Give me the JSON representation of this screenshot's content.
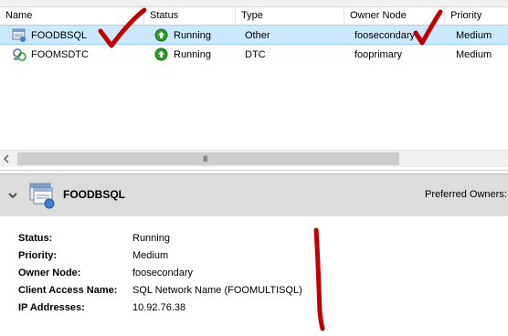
{
  "list": {
    "columns": [
      "Name",
      "Status",
      "Type",
      "Owner Node",
      "Priority"
    ],
    "rows": [
      {
        "name": "FOODBSQL",
        "status": "Running",
        "type": "Other",
        "owner": "foosecondary",
        "priority": "Medium",
        "icon": "sql-role-icon",
        "selected": true
      },
      {
        "name": "FOOMSDTC",
        "status": "Running",
        "type": "DTC",
        "owner": "fooprimary",
        "priority": "Medium",
        "icon": "dtc-role-icon",
        "selected": false
      }
    ],
    "scrollbar_grip": "III"
  },
  "details": {
    "title": "FOODBSQL",
    "preferred_owners_label": "Preferred Owners:",
    "fields": [
      {
        "label": "Status:",
        "value": "Running"
      },
      {
        "label": "Priority:",
        "value": "Medium"
      },
      {
        "label": "Owner Node:",
        "value": "foosecondary"
      },
      {
        "label": "Client Access Name:",
        "value": "SQL Network Name (FOOMULTISQL)"
      },
      {
        "label": "IP Addresses:",
        "value": "10.92.76.38"
      }
    ]
  },
  "colors": {
    "selection": "#cce8ff",
    "annotation_red": "#c00000",
    "status_green": "#2e9b2e"
  }
}
